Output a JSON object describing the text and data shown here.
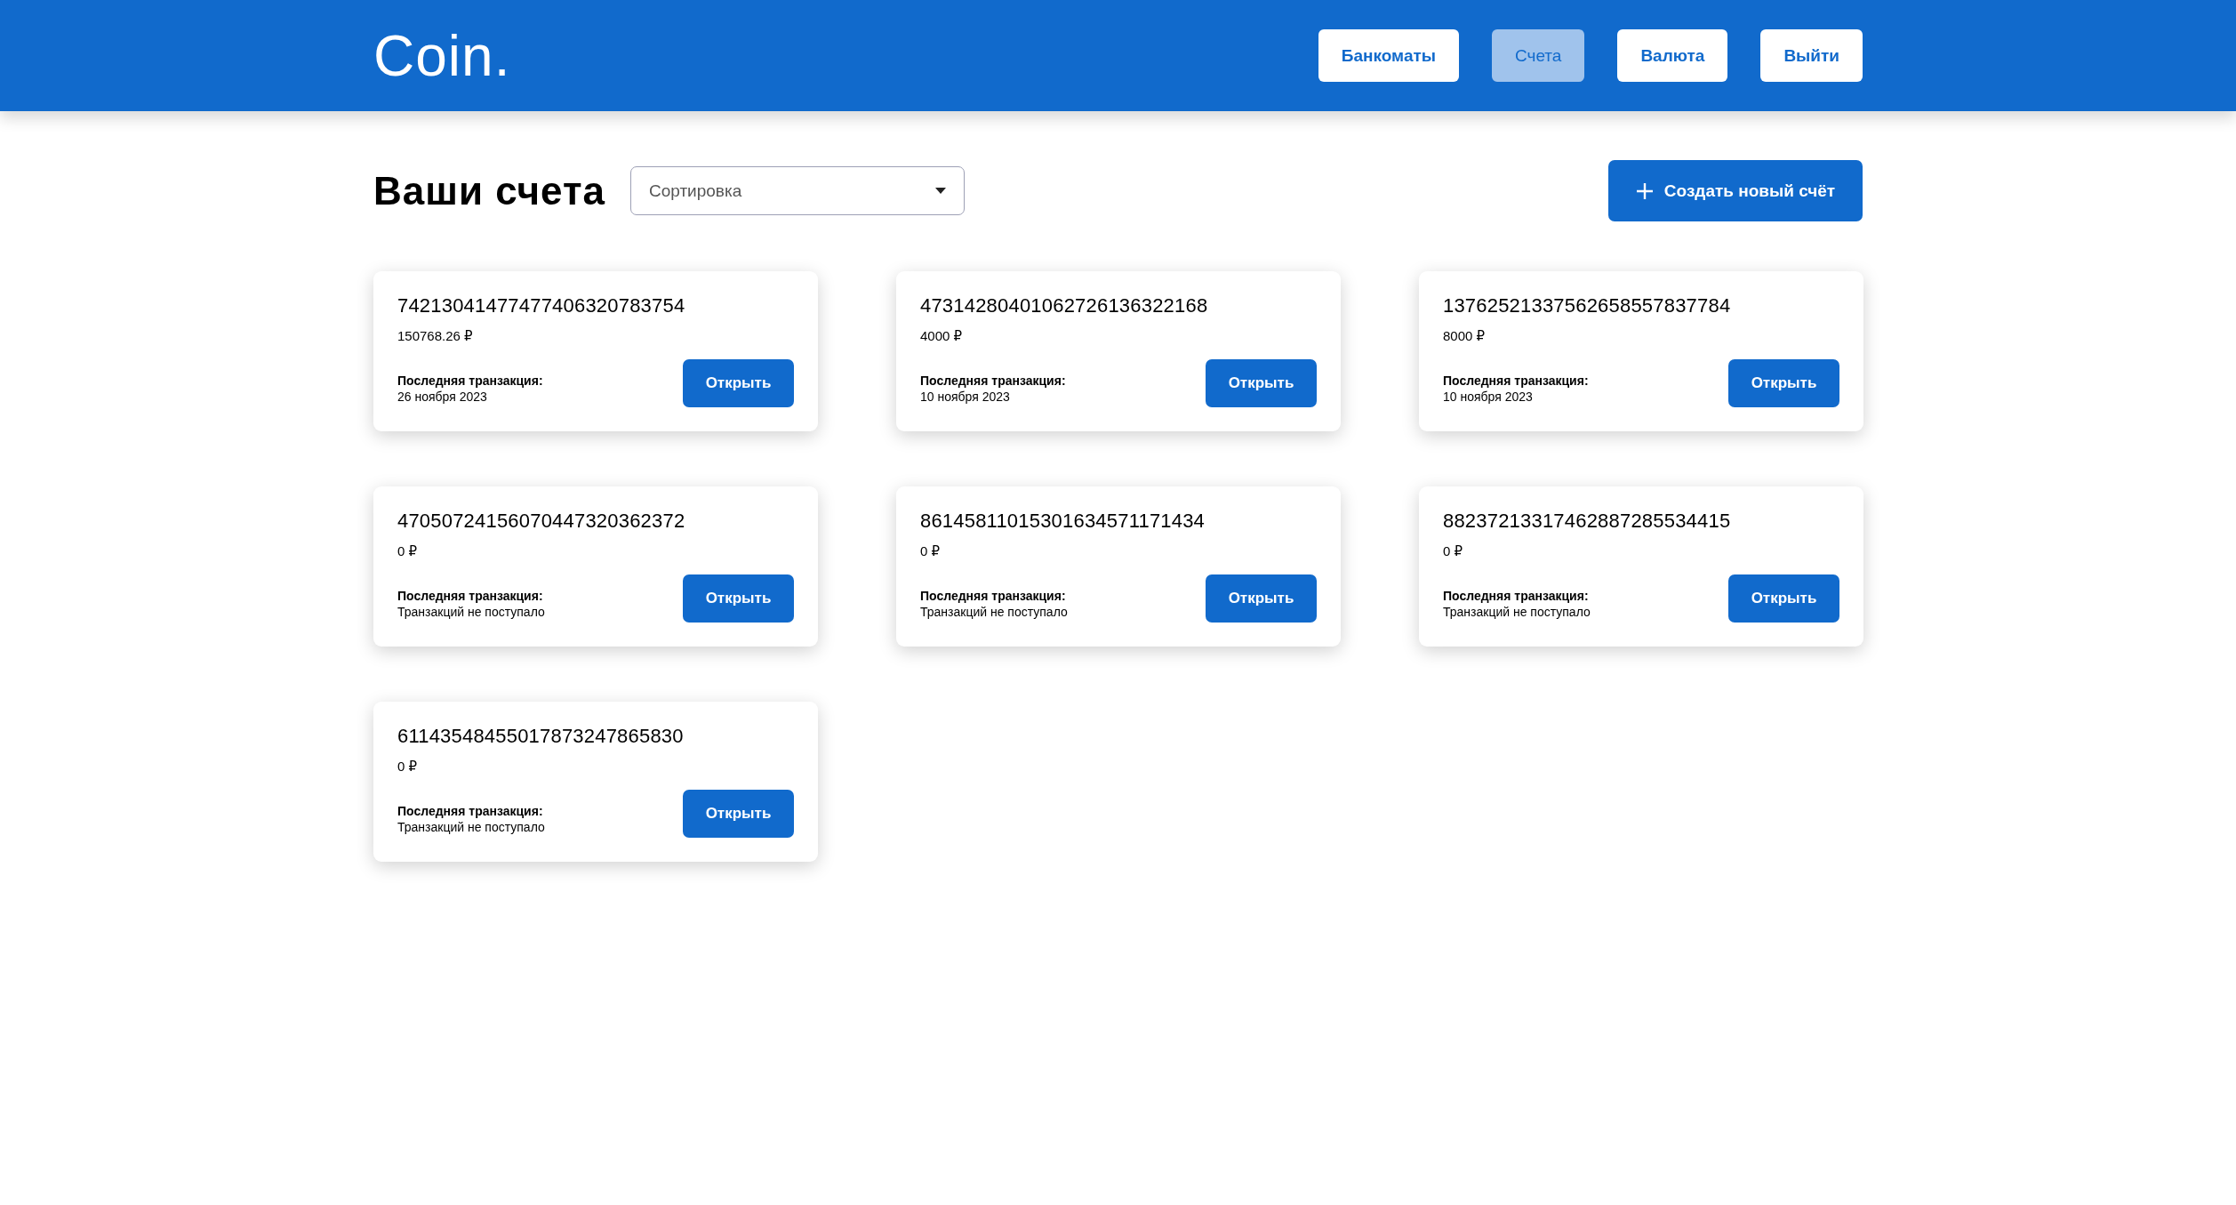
{
  "header": {
    "logo": "Coin.",
    "nav": [
      {
        "label": "Банкоматы",
        "selected": false
      },
      {
        "label": "Счета",
        "selected": true
      },
      {
        "label": "Валюта",
        "selected": false
      },
      {
        "label": "Выйти",
        "selected": false
      }
    ]
  },
  "toolbar": {
    "title": "Ваши счета",
    "sort": {
      "placeholder": "Сортировка"
    },
    "create_button": "Создать новый счёт"
  },
  "accounts": [
    {
      "number": "74213041477477406320783754",
      "balance": "150768.26 ₽",
      "last_label": "Последняя транзакция:",
      "last_value": "26 ноября 2023",
      "button": "Открыть"
    },
    {
      "number": "47314280401062726136322168",
      "balance": "4000 ₽",
      "last_label": "Последняя транзакция:",
      "last_value": "10 ноября 2023",
      "button": "Открыть"
    },
    {
      "number": "13762521337562658557837784",
      "balance": "8000 ₽",
      "last_label": "Последняя транзакция:",
      "last_value": "10 ноября 2023",
      "button": "Открыть"
    },
    {
      "number": "47050724156070447320362372",
      "balance": "0 ₽",
      "last_label": "Последняя транзакция:",
      "last_value": "Транзакций не поступало",
      "button": "Открыть"
    },
    {
      "number": "86145811015301634571171434",
      "balance": "0 ₽",
      "last_label": "Последняя транзакция:",
      "last_value": "Транзакций не поступало",
      "button": "Открыть"
    },
    {
      "number": "88237213317462887285534415",
      "balance": "0 ₽",
      "last_label": "Последняя транзакция:",
      "last_value": "Транзакций не поступало",
      "button": "Открыть"
    },
    {
      "number": "61143548455017873247865830",
      "balance": "0 ₽",
      "last_label": "Последняя транзакция:",
      "last_value": "Транзакций не поступало",
      "button": "Открыть"
    }
  ]
}
